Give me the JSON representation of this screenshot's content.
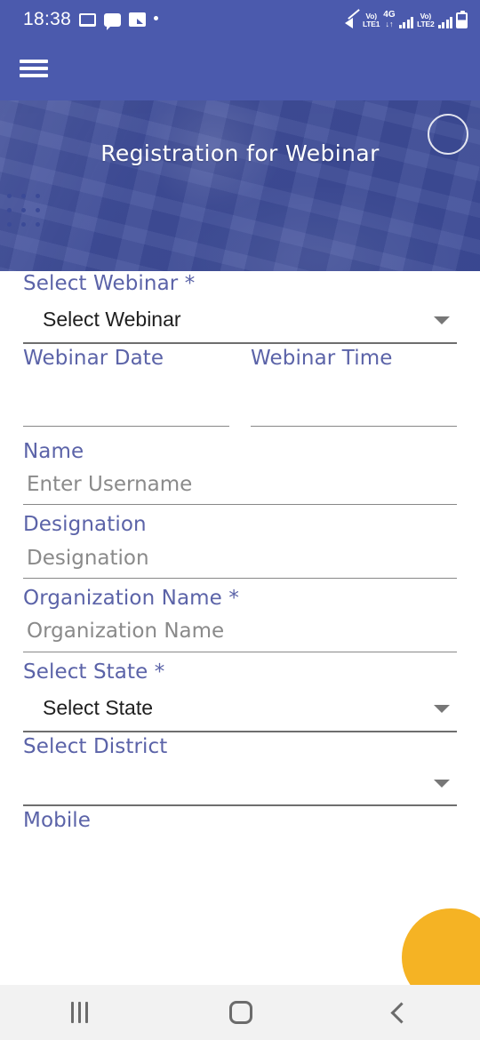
{
  "status_bar": {
    "time": "18:38",
    "left_icons": [
      "screen-cast-icon",
      "chat-icon",
      "image-icon",
      "dot-icon"
    ],
    "network": {
      "mute_icon": "mute-icon",
      "sim1_volte": "Vo)",
      "sim1_label": "LTE1",
      "data_type": "4G",
      "data_arrows": "↓↑",
      "sim2_volte": "Vo)",
      "sim2_label": "LTE2",
      "battery_icon": "battery-icon"
    }
  },
  "app_bar": {
    "menu_icon": "hamburger-menu-icon"
  },
  "hero": {
    "title": "Registration for Webinar",
    "circle_decoration": "circle-outline-decoration",
    "dot_grid_decoration": "dot-grid-decoration"
  },
  "colors": {
    "app_bar": "#4b5aad",
    "banner": "#3f4d99",
    "label": "#5b63a8",
    "fab": "#f5b324",
    "nav_bar": "#f2f2f2",
    "underline": "#6e6e6e"
  },
  "form": {
    "fields": [
      {
        "key": "select_webinar",
        "label": "Select Webinar",
        "required": true,
        "type": "select",
        "value": "Select Webinar"
      },
      {
        "key": "webinar_date",
        "label": "Webinar Date",
        "required": false,
        "type": "text",
        "value": ""
      },
      {
        "key": "webinar_time",
        "label": "Webinar Time",
        "required": false,
        "type": "text",
        "value": ""
      },
      {
        "key": "name",
        "label": "Name",
        "required": false,
        "type": "text",
        "placeholder": "Enter Username",
        "value": ""
      },
      {
        "key": "designation",
        "label": "Designation",
        "required": false,
        "type": "text",
        "placeholder": "Designation",
        "value": ""
      },
      {
        "key": "organization_name",
        "label": "Organization Name",
        "required": true,
        "type": "text",
        "placeholder": "Organization Name",
        "value": ""
      },
      {
        "key": "select_state",
        "label": "Select State",
        "required": true,
        "type": "select",
        "value": "Select State"
      },
      {
        "key": "select_district",
        "label": "Select District",
        "required": false,
        "type": "select",
        "value": ""
      },
      {
        "key": "mobile",
        "label": "Mobile",
        "required": false,
        "type": "text",
        "value": ""
      }
    ],
    "required_marker": "*"
  },
  "fab": {
    "name": "floating-action-button"
  },
  "nav_bar": {
    "recents_label": "recents-icon",
    "home_label": "home-icon",
    "back_label": "back-icon"
  }
}
